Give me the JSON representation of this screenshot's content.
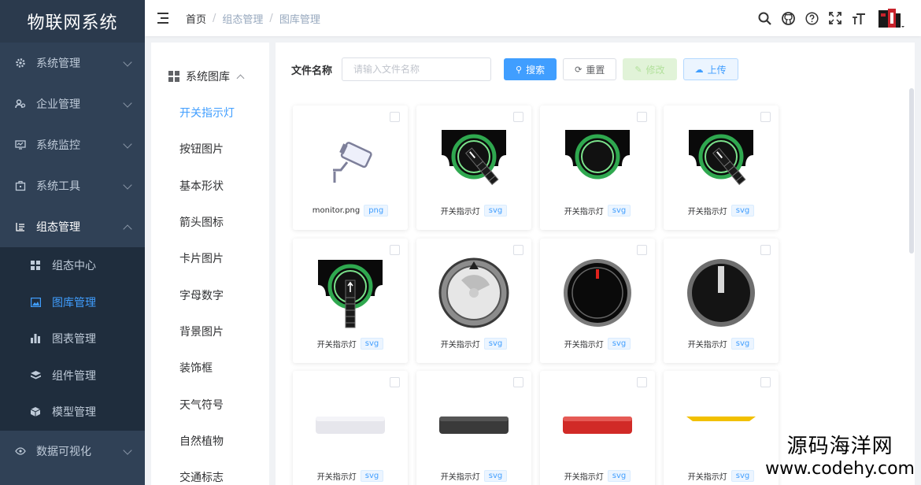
{
  "app": {
    "title": "物联网系统"
  },
  "sidebar": {
    "items": [
      {
        "label": "系统管理",
        "icon": "gear-icon"
      },
      {
        "label": "企业管理",
        "icon": "users-icon"
      },
      {
        "label": "系统监控",
        "icon": "monitor-icon"
      },
      {
        "label": "系统工具",
        "icon": "toolbox-icon"
      },
      {
        "label": "组态管理",
        "icon": "list-icon",
        "open": true
      },
      {
        "label": "数据可视化",
        "icon": "eye-icon"
      }
    ],
    "submenu": [
      {
        "label": "组态中心",
        "icon": "grid-icon"
      },
      {
        "label": "图库管理",
        "icon": "image-icon",
        "active": true
      },
      {
        "label": "图表管理",
        "icon": "bar-chart-icon"
      },
      {
        "label": "组件管理",
        "icon": "component-icon"
      },
      {
        "label": "模型管理",
        "icon": "cube-icon"
      }
    ]
  },
  "header": {
    "breadcrumb": [
      "首页",
      "组态管理",
      "图库管理"
    ],
    "icons": [
      "search-icon",
      "github-icon",
      "help-icon",
      "fullscreen-icon",
      "font-size-icon"
    ]
  },
  "categories": {
    "title": "系统图库",
    "items": [
      "开关指示灯",
      "按钮图片",
      "基本形状",
      "箭头图标",
      "卡片图片",
      "字母数字",
      "背景图片",
      "装饰框",
      "天气符号",
      "自然植物",
      "交通标志"
    ]
  },
  "toolbar": {
    "file_label": "文件名称",
    "search_placeholder": "请输入文件名称",
    "search_label": "搜索",
    "reset_label": "重置",
    "edit_label": "修改",
    "upload_label": "上传"
  },
  "cards": [
    {
      "name": "monitor.png",
      "type": "png",
      "art": "camera"
    },
    {
      "name": "开关指示灯",
      "type": "svg",
      "art": "switch-knob"
    },
    {
      "name": "开关指示灯",
      "type": "svg",
      "art": "switch-ring"
    },
    {
      "name": "开关指示灯",
      "type": "svg",
      "art": "switch-knob"
    },
    {
      "name": "开关指示灯",
      "type": "svg",
      "art": "switch-up"
    },
    {
      "name": "开关指示灯",
      "type": "svg",
      "art": "dial-gray"
    },
    {
      "name": "开关指示灯",
      "type": "svg",
      "art": "dial-black-red"
    },
    {
      "name": "开关指示灯",
      "type": "svg",
      "art": "dial-black"
    },
    {
      "name": "开关指示灯",
      "type": "svg",
      "art": "bar-light"
    },
    {
      "name": "开关指示灯",
      "type": "svg",
      "art": "bar-dark"
    },
    {
      "name": "开关指示灯",
      "type": "svg",
      "art": "bar-red"
    },
    {
      "name": "开关指示灯",
      "type": "svg",
      "art": "bar-yellow"
    }
  ],
  "watermark": {
    "line1": "源码海洋网",
    "line2": "www.codehy.com"
  },
  "colors": {
    "sidebar": "#304156",
    "accent": "#409eff"
  }
}
